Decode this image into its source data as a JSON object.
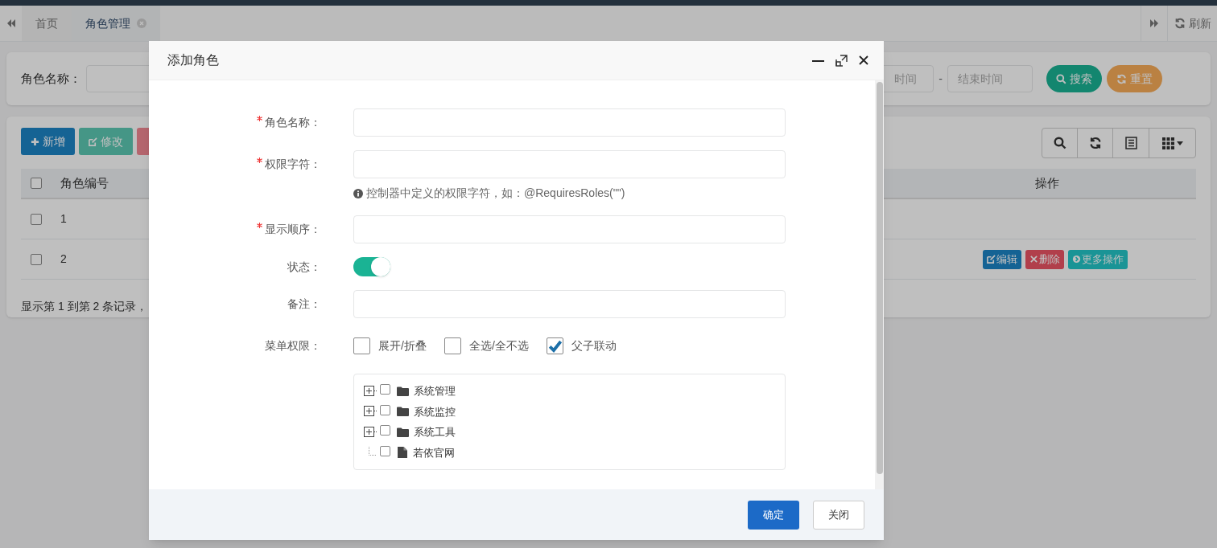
{
  "tab_bar": {
    "tabs": [
      {
        "label": "首页",
        "selected": false,
        "closable": false
      },
      {
        "label": "角色管理",
        "selected": true,
        "closable": true
      }
    ],
    "refresh_label": "刷新"
  },
  "search_form": {
    "name_label": "角色名称：",
    "start_time_placeholder": "时间",
    "separator": "-",
    "end_time_placeholder": "结束时间",
    "buttons": [
      {
        "label": "搜索",
        "kind": "search"
      },
      {
        "label": "重置",
        "kind": "reset"
      }
    ]
  },
  "toolbar": {
    "buttons": [
      {
        "label": "新增",
        "kind": "add"
      },
      {
        "label": "修改",
        "kind": "edit"
      }
    ]
  },
  "table": {
    "columns": [
      "角色编号",
      "操作"
    ],
    "header_checked": false,
    "rows": [
      {
        "id": "1",
        "checked": false,
        "actions": []
      },
      {
        "id": "2",
        "checked": false,
        "actions": [
          {
            "label": "编辑",
            "kind": "edit"
          },
          {
            "label": "删除",
            "kind": "delete"
          },
          {
            "label": "更多操作",
            "kind": "more"
          }
        ]
      }
    ],
    "summary": "显示第 1 到第 2 条记录，"
  },
  "dialog": {
    "title": "添加角色",
    "fields": [
      {
        "kind": "text",
        "label": "角色名称：",
        "required": true
      },
      {
        "kind": "text",
        "label": "权限字符：",
        "required": true,
        "hint": "控制器中定义的权限字符，如：@RequiresRoles(\"\")"
      },
      {
        "kind": "text",
        "label": "显示顺序：",
        "required": true
      },
      {
        "kind": "toggle",
        "label": "状态：",
        "required": false,
        "on": true
      },
      {
        "kind": "text",
        "label": "备注：",
        "required": false
      },
      {
        "kind": "checks",
        "label": "菜单权限：",
        "required": false,
        "options": [
          {
            "label": "展开/折叠",
            "checked": false
          },
          {
            "label": "全选/全不选",
            "checked": false
          },
          {
            "label": "父子联动",
            "checked": true
          }
        ]
      }
    ],
    "tree": [
      {
        "label": "系统管理",
        "kind": "folder",
        "expanded": false,
        "checked": false
      },
      {
        "label": "系统监控",
        "kind": "folder",
        "expanded": false,
        "checked": false
      },
      {
        "label": "系统工具",
        "kind": "folder",
        "expanded": false,
        "checked": false
      },
      {
        "label": "若依官网",
        "kind": "file",
        "checked": false
      }
    ],
    "buttons": [
      {
        "label": "确定",
        "kind": "primary"
      },
      {
        "label": "关闭",
        "kind": "default"
      }
    ]
  }
}
